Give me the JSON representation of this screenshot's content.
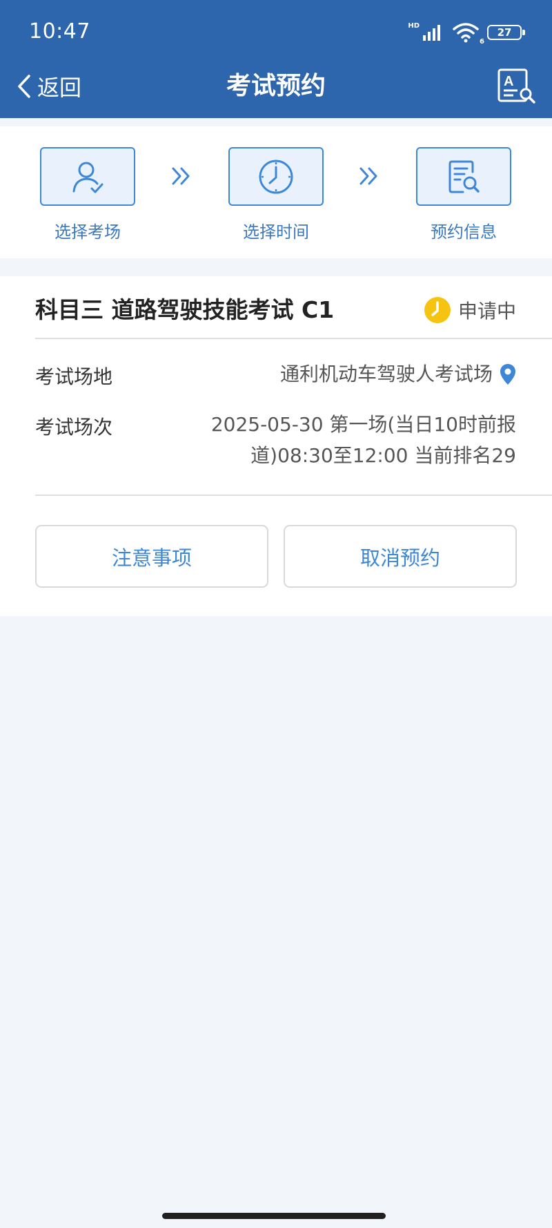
{
  "status_bar": {
    "time": "10:47",
    "network": "HD",
    "wifi_badge": "6",
    "battery": "27"
  },
  "header": {
    "back_label": "返回",
    "title": "考试预约",
    "action_icon": "document-search-icon"
  },
  "steps": [
    {
      "label": "选择考场",
      "icon": "user-check-icon"
    },
    {
      "label": "选择时间",
      "icon": "clock-icon"
    },
    {
      "label": "预约信息",
      "icon": "document-search-icon"
    }
  ],
  "appointment": {
    "title": "科目三 道路驾驶技能考试 C1",
    "status": "申请中",
    "venue_label": "考试场地",
    "venue_value": "通利机动车驾驶人考试场",
    "session_label": "考试场次",
    "session_value_line1": "2025-05-30 第一场(当日10时前报",
    "session_value_line2": "道)08:30至12:00 当前排名29"
  },
  "actions": {
    "notice_label": "注意事项",
    "cancel_label": "取消预约"
  },
  "colors": {
    "header_bg": "#2d66ad",
    "accent": "#3d87d6",
    "status_yellow": "#f6c310",
    "page_bg": "#f2f5f9"
  }
}
